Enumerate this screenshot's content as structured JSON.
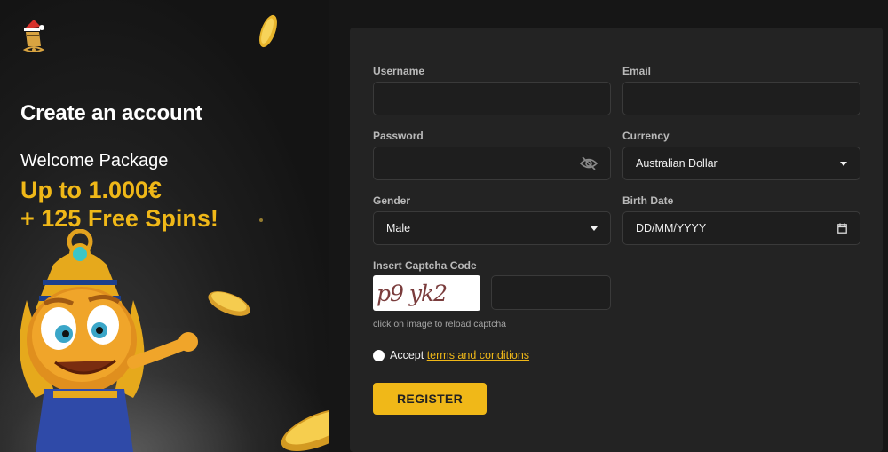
{
  "promo": {
    "title": "Create an account",
    "package_label": "Welcome Package",
    "amount_line1": "Up to 1.000€",
    "amount_line2": "+ 125 Free Spins!"
  },
  "form": {
    "username_label": "Username",
    "username_value": "",
    "email_label": "Email",
    "email_value": "",
    "password_label": "Password",
    "password_value": "",
    "currency_label": "Currency",
    "currency_value": "Australian Dollar",
    "gender_label": "Gender",
    "gender_value": "Male",
    "birthdate_label": "Birth Date",
    "birthdate_placeholder": "DD/MM/YYYY",
    "captcha_label": "Insert Captcha Code",
    "captcha_text": "p9 yk2",
    "captcha_value": "",
    "captcha_hint": "click on image to reload captcha",
    "accept_text": "Accept",
    "terms_link": "terms and conditions",
    "register_label": "REGISTER"
  },
  "colors": {
    "accent": "#f0b818",
    "panel": "#232323",
    "background": "#161616"
  },
  "icons": {
    "password_toggle": "eye-off-icon",
    "calendar": "calendar-icon",
    "dropdown": "chevron-down-icon"
  }
}
